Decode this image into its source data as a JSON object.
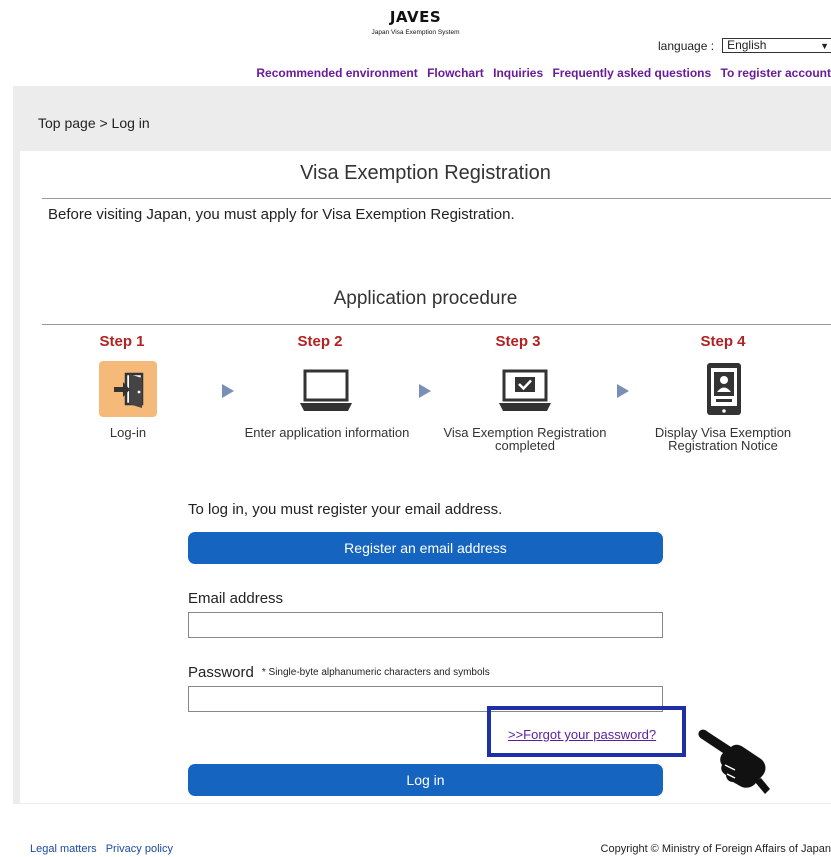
{
  "header": {
    "app_title": "JAVES",
    "app_subtitle": "Japan Visa Exemption System",
    "language_label": "language :",
    "language_selected": "English",
    "nav": [
      "Recommended environment",
      "Flowchart",
      "Inquiries",
      "Frequently asked questions",
      "To register account"
    ]
  },
  "breadcrumb": "Top page > Log in",
  "main": {
    "title": "Visa Exemption Registration",
    "intro": "Before visiting Japan, you must apply for Visa Exemption Registration.",
    "procedure_title": "Application procedure",
    "steps": [
      {
        "label": "Step 1",
        "text": "Log-in",
        "icon": "door-exit-icon"
      },
      {
        "label": "Step 2",
        "text": "Enter application information",
        "icon": "laptop-icon"
      },
      {
        "label": "Step 3",
        "text": "Visa Exemption Registration completed",
        "icon": "laptop-check-icon"
      },
      {
        "label": "Step 4",
        "text": "Display Visa Exemption Registration Notice",
        "icon": "phone-id-icon"
      }
    ]
  },
  "login": {
    "register_prompt": "To log in, you must register your email address.",
    "register_button": "Register an email address",
    "email_label": "Email address",
    "email_value": "",
    "password_label": "Password",
    "password_note": "* Single-byte alphanumeric characters and symbols",
    "password_value": "",
    "forgot_link": ">>Forgot your password?",
    "login_button": "Log in"
  },
  "footer": {
    "links": [
      "Legal matters",
      "Privacy policy"
    ],
    "copyright": "Copyright © Ministry of Foreign Affairs of Japan"
  },
  "colors": {
    "accent_blue": "#1565c0",
    "step_red": "#b22222",
    "nav_purple": "#6a1b9a",
    "highlight_box": "#1f2fa8",
    "step1_icon_bg": "#f5b97a"
  }
}
